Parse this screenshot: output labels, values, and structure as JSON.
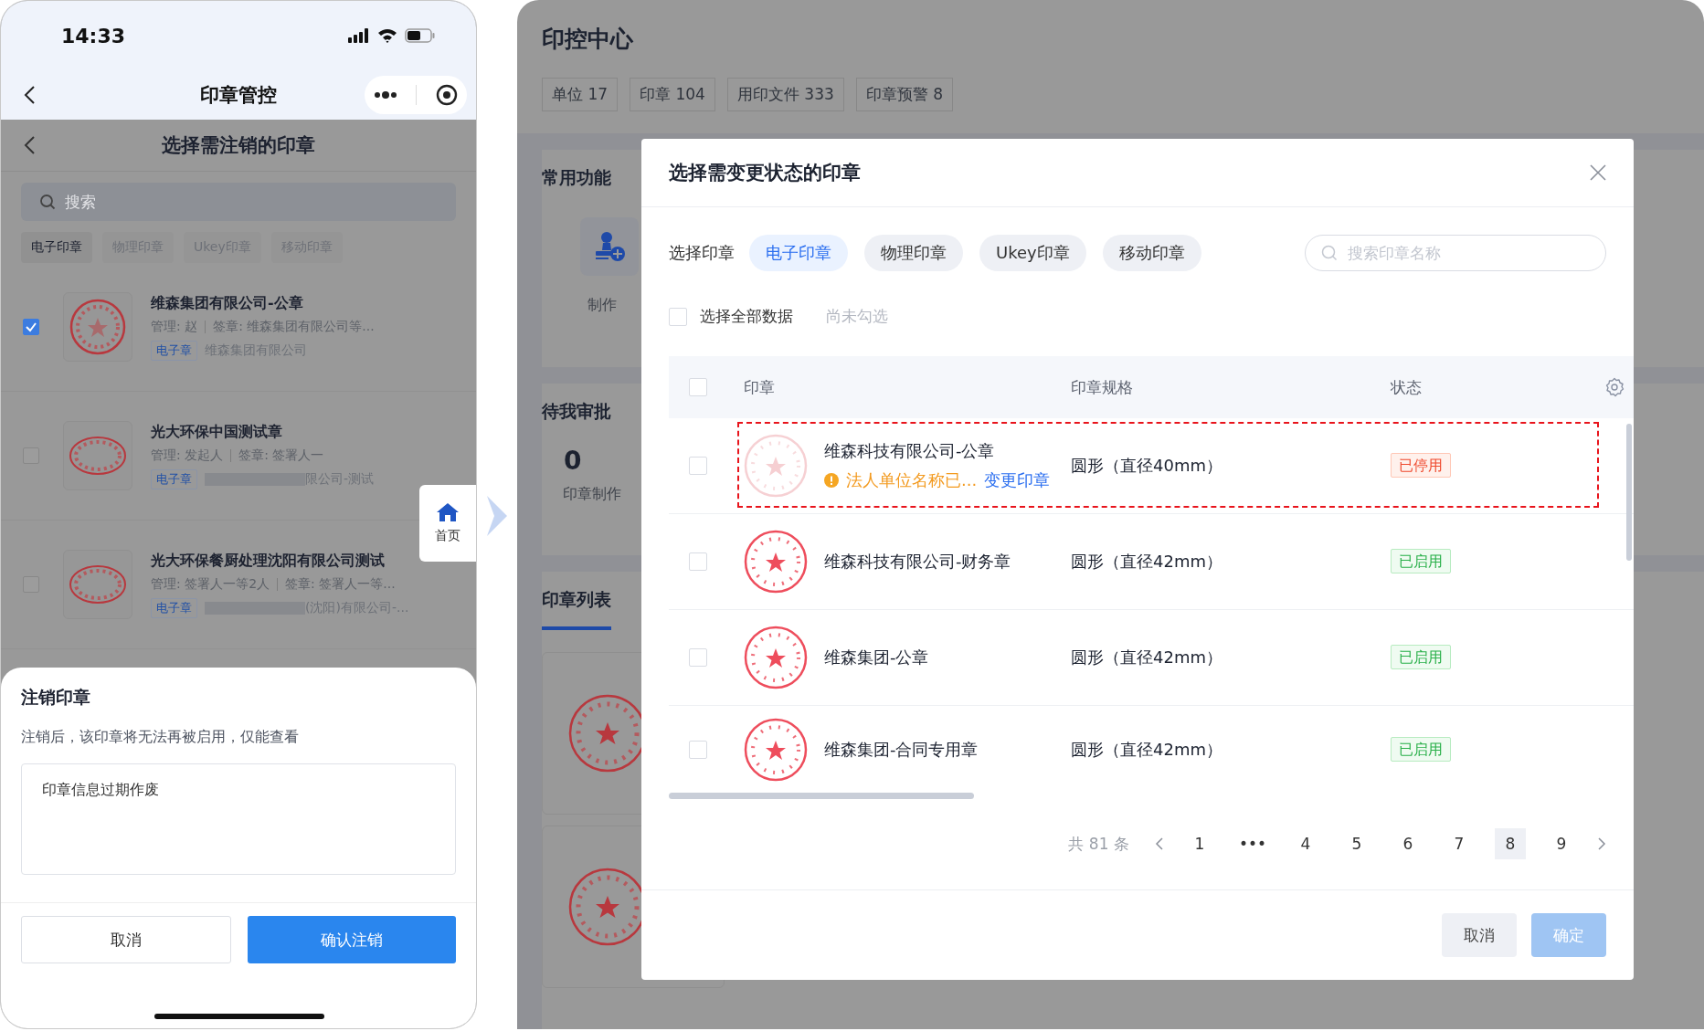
{
  "phone": {
    "status_bar": {
      "time": "14:33"
    },
    "nav": {
      "title": "印章管控"
    },
    "subpage": {
      "title": "选择需注销的印章",
      "search": {
        "placeholder": "搜索"
      },
      "filters": [
        {
          "label": "电子印章",
          "selected": true
        },
        {
          "label": "物理印章",
          "selected": false
        },
        {
          "label": "Ukey印章",
          "selected": false
        },
        {
          "label": "移动印章",
          "selected": false
        }
      ],
      "seals": [
        {
          "name": "维森集团有限公司-公章",
          "kind": "round",
          "manager": "管理: 赵",
          "signer": "签章: 维森集团有限公司等...",
          "tag": "电子章",
          "org": "维森集团有限公司",
          "org_masked": false,
          "checked": true
        },
        {
          "name": "光大环保中国测试章",
          "kind": "oval",
          "manager": "管理: 发起人",
          "signer": "签章: 签署人一",
          "tag": "电子章",
          "org": "限公司-测试",
          "org_masked": true,
          "checked": false
        },
        {
          "name": "光大环保餐厨处理沈阳有限公司测试",
          "kind": "oval",
          "manager": "管理: 签署人一等2人",
          "signer": "签章: 签署人一等...",
          "tag": "电子章",
          "org": "(沈阳)有限公司-...",
          "org_masked": true,
          "checked": false
        }
      ]
    },
    "home_button": {
      "label": "首页"
    },
    "sheet": {
      "title": "注销印章",
      "description": "注销后，该印章将无法再被启用，仅能查看",
      "reason": "印章信息过期作废",
      "buttons": [
        {
          "label": "取消",
          "kind": "secondary"
        },
        {
          "label": "确认注销",
          "kind": "primary"
        }
      ]
    }
  },
  "desktop": {
    "title": "印控中心",
    "stats": [
      "单位 17",
      "印章 104",
      "用印文件 333",
      "印章预警 8"
    ],
    "common": {
      "title": "常用功能",
      "action": "制作"
    },
    "approval": {
      "title": "待我审批",
      "count": "0",
      "label": "印章制作"
    },
    "tabs": [
      {
        "label": "印章列表",
        "selected": true
      }
    ],
    "modal": {
      "title": "选择需变更状态的印章",
      "filter_label": "选择印章",
      "filters": [
        {
          "label": "电子印章",
          "selected": true
        },
        {
          "label": "物理印章",
          "selected": false
        },
        {
          "label": "Ukey印章",
          "selected": false
        },
        {
          "label": "移动印章",
          "selected": false
        }
      ],
      "search": {
        "placeholder": "搜索印章名称"
      },
      "select_all": {
        "label": "选择全部数据",
        "checked": false
      },
      "selection_hint": "尚未勾选",
      "header_checked": false,
      "columns": [
        "印章",
        "印章规格",
        "状态"
      ],
      "rows": [
        {
          "name": "维森科技有限公司-公章",
          "spec": "圆形（直径40mm）",
          "status": "已停用",
          "kind": "stopped",
          "checked": false,
          "faded": true,
          "highlighted": true,
          "warning": "法人单位名称已...",
          "action": "变更印章"
        },
        {
          "name": "维森科技有限公司-财务章",
          "spec": "圆形（直径42mm）",
          "status": "已启用",
          "kind": "active",
          "checked": false,
          "faded": false,
          "highlighted": false
        },
        {
          "name": "维森集团-公章",
          "spec": "圆形（直径42mm）",
          "status": "已启用",
          "kind": "active",
          "checked": false,
          "faded": false,
          "highlighted": false
        },
        {
          "name": "维森集团-合同专用章",
          "spec": "圆形（直径42mm）",
          "status": "已启用",
          "kind": "active",
          "checked": false,
          "faded": false,
          "highlighted": false
        }
      ],
      "pagination": {
        "total": "共 81 条",
        "pages": [
          {
            "label": "1",
            "selected": false
          },
          {
            "label": "•••",
            "selected": false
          },
          {
            "label": "4",
            "selected": false
          },
          {
            "label": "5",
            "selected": false
          },
          {
            "label": "6",
            "selected": false
          },
          {
            "label": "7",
            "selected": false
          },
          {
            "label": "8",
            "selected": true
          },
          {
            "label": "9",
            "selected": false
          }
        ]
      },
      "buttons": [
        {
          "label": "取消",
          "kind": "secondary",
          "disabled": false
        },
        {
          "label": "确定",
          "kind": "primary",
          "disabled": true
        }
      ]
    }
  }
}
